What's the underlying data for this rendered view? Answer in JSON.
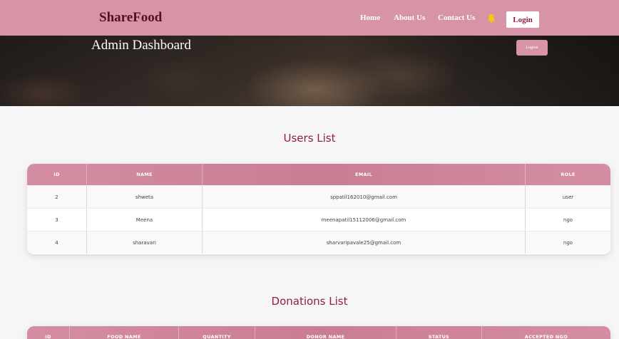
{
  "nav": {
    "brand": "ShareFood",
    "links": [
      "Home",
      "About Us",
      "Contact Us"
    ],
    "login_label": "Login",
    "bell_icon": "bell-icon",
    "accent_color": "#d694a6"
  },
  "hero": {
    "title": "Admin Dashboard",
    "logout_label": "Logout"
  },
  "users": {
    "title": "Users List",
    "columns": [
      "ID",
      "NAME",
      "EMAIL",
      "ROLE"
    ],
    "rows": [
      [
        "2",
        "shweta",
        "sppatil162010@gmail.com",
        "user"
      ],
      [
        "3",
        "Meena",
        "meenapatil15112006@gmail.com",
        "ngo"
      ],
      [
        "4",
        "sharavari",
        "sharvaripavale25@gmail.com",
        "ngo"
      ]
    ]
  },
  "donations": {
    "title": "Donations List",
    "columns": [
      "ID",
      "FOOD NAME",
      "QUANTITY",
      "DONOR NAME",
      "STATUS",
      "ACCEPTED NGO"
    ]
  }
}
